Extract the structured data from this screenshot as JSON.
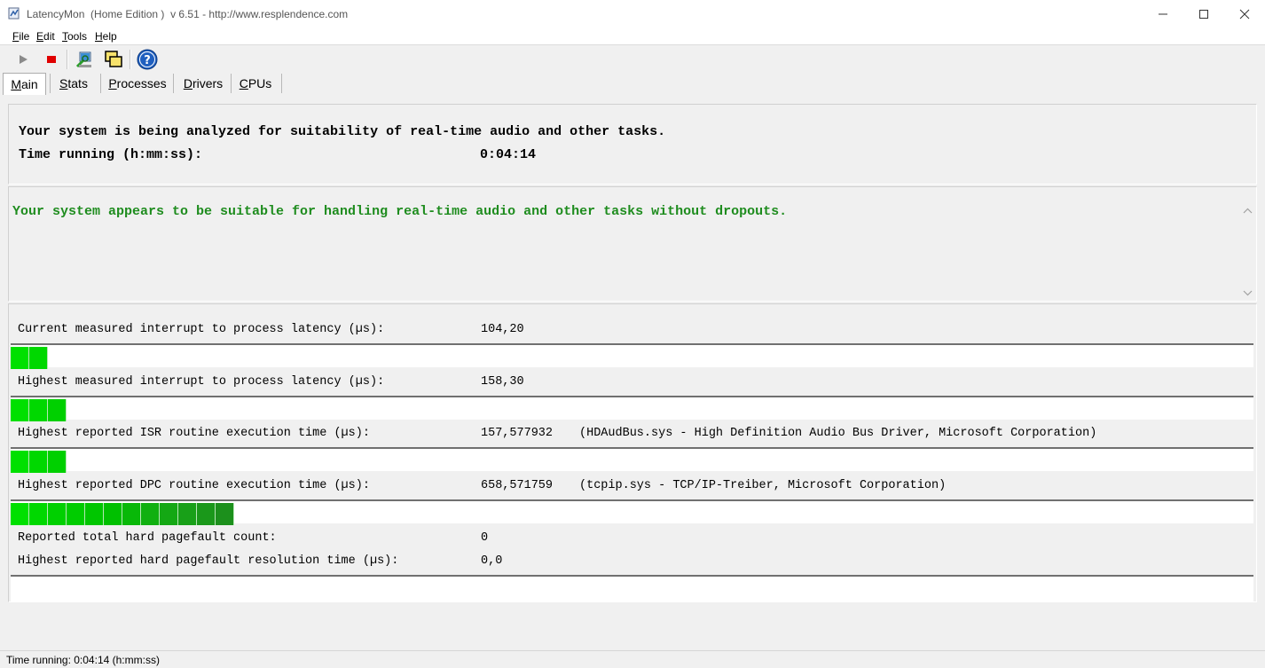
{
  "window": {
    "title": "LatencyMon  (Home Edition )  v 6.51 - http://www.resplendence.com",
    "icons": {
      "app": "latencymon-app-icon",
      "minimize": "minimize-icon",
      "maximize": "maximize-icon",
      "close": "close-icon"
    }
  },
  "menu": {
    "items": [
      {
        "accel": "F",
        "rest": "ile"
      },
      {
        "accel": "E",
        "rest": "dit"
      },
      {
        "accel": "T",
        "rest": "ools"
      },
      {
        "accel": "H",
        "rest": "elp"
      }
    ]
  },
  "toolbar": {
    "buttons": [
      "play-icon",
      "stop-icon",
      "analyze-icon",
      "windows-icon",
      "help-icon"
    ],
    "colors": {
      "stop": "#e00000",
      "play": "#8a8a8a",
      "help": "#1f5fbf"
    }
  },
  "tabs": [
    {
      "accel": "M",
      "rest": "ain",
      "selected": true
    },
    {
      "accel": "S",
      "rest": "tats",
      "selected": false
    },
    {
      "accel": "P",
      "rest": "rocesses",
      "selected": false
    },
    {
      "accel": "D",
      "rest": "rivers",
      "selected": false
    },
    {
      "accel": "C",
      "rest": "PUs",
      "selected": false
    }
  ],
  "status": {
    "analyzing_line": "Your system is being analyzed for suitability of real-time audio and other tasks.",
    "time_label": "Time running (h:mm:ss):",
    "time_value": "0:04:14"
  },
  "result": {
    "message": "Your system appears to be suitable for handling real-time audio and other tasks without dropouts.",
    "color": "#1e8c1e"
  },
  "metrics": {
    "current_latency": {
      "label": "Current measured interrupt to process latency (µs):",
      "value": "104,20",
      "bar_segments": 2
    },
    "highest_latency": {
      "label": "Highest measured interrupt to process latency (µs):",
      "value": "158,30",
      "bar_segments": 3
    },
    "highest_isr": {
      "label": "Highest reported ISR routine execution time (µs):",
      "value": "157,577932",
      "detail": "(HDAudBus.sys - High Definition Audio Bus Driver, Microsoft Corporation)",
      "bar_segments": 3
    },
    "highest_dpc": {
      "label": "Highest reported DPC routine execution time (µs):",
      "value": "658,571759",
      "detail": "(tcpip.sys - TCP/IP-Treiber, Microsoft Corporation)",
      "bar_segments": 12
    },
    "pagefault_count": {
      "label": "Reported total hard pagefault count:",
      "value": "0"
    },
    "pagefault_time": {
      "label": "Highest reported hard pagefault resolution time (µs):",
      "value": "0,0",
      "bar_segments": 0
    }
  },
  "bar_colors": [
    "#00e000",
    "#00d800",
    "#00d000",
    "#00cc00",
    "#00c600",
    "#00c000",
    "#08b808",
    "#10b010",
    "#14a814",
    "#18a018",
    "#1a981a",
    "#1c901c"
  ],
  "statusbar": {
    "text": "Time running: 0:04:14  (h:mm:ss)"
  }
}
